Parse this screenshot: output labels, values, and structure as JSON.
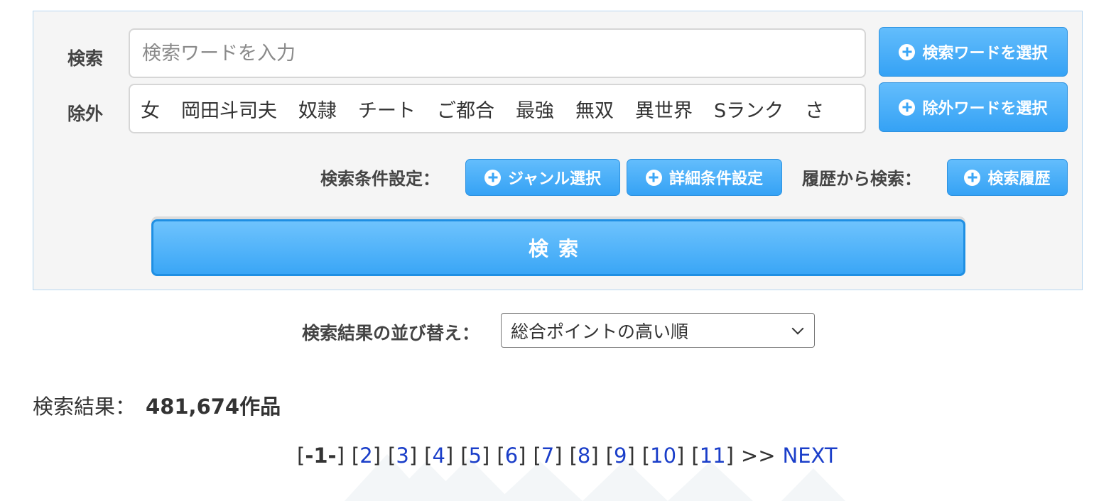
{
  "search": {
    "label": "検索",
    "placeholder": "検索ワードを入力",
    "select_button": "検索ワードを選択"
  },
  "exclude": {
    "label": "除外",
    "words": [
      "女",
      "岡田斗司夫",
      "奴隷",
      "チート",
      "ご都合",
      "最強",
      "無双",
      "異世界",
      "Sランク",
      "さ"
    ],
    "select_button": "除外ワードを選択"
  },
  "conditions": {
    "label": "検索条件設定：",
    "genre_button": "ジャンル選択",
    "detail_button": "詳細条件設定",
    "history_label": "履歴から検索：",
    "history_button": "検索履歴"
  },
  "submit_label": "検索",
  "sort": {
    "label": "検索結果の並び替え：",
    "selected": "総合ポイントの高い順"
  },
  "results": {
    "label": "検索結果：",
    "count": "481,674作品"
  },
  "pagination": {
    "current": "-1-",
    "pages": [
      "2",
      "3",
      "4",
      "5",
      "6",
      "7",
      "8",
      "9",
      "10",
      "11"
    ],
    "arrow": ">>",
    "next": "NEXT"
  }
}
